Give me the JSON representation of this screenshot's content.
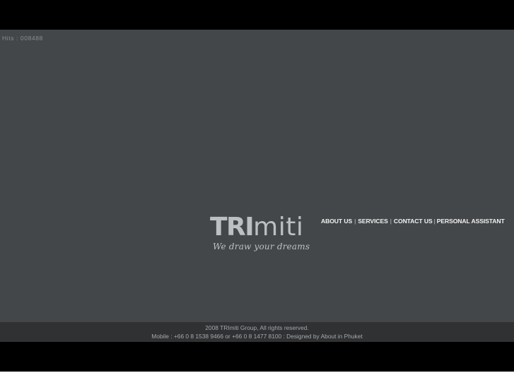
{
  "hits": {
    "text": "Hits : 008488"
  },
  "logo": {
    "word_bold": "TRI",
    "word_light": "miti",
    "tagline": "We draw your dreams"
  },
  "nav": {
    "items": [
      {
        "label": "ABOUT US"
      },
      {
        "label": "SERVICES"
      },
      {
        "label": "CONTACT US"
      },
      {
        "label": "PERSONAL ASSISTANT"
      }
    ],
    "separator": "|"
  },
  "footer": {
    "copyright": "2008 TRImiti Group, All rights reserved.",
    "contact": "Mobile : +66 0 8 1538 9466 or +66 0 8 1477 8100 : Designed by About in Phuket"
  },
  "colors": {
    "background": "#43474a",
    "bars": "#000000",
    "footer": "#2f3133"
  }
}
